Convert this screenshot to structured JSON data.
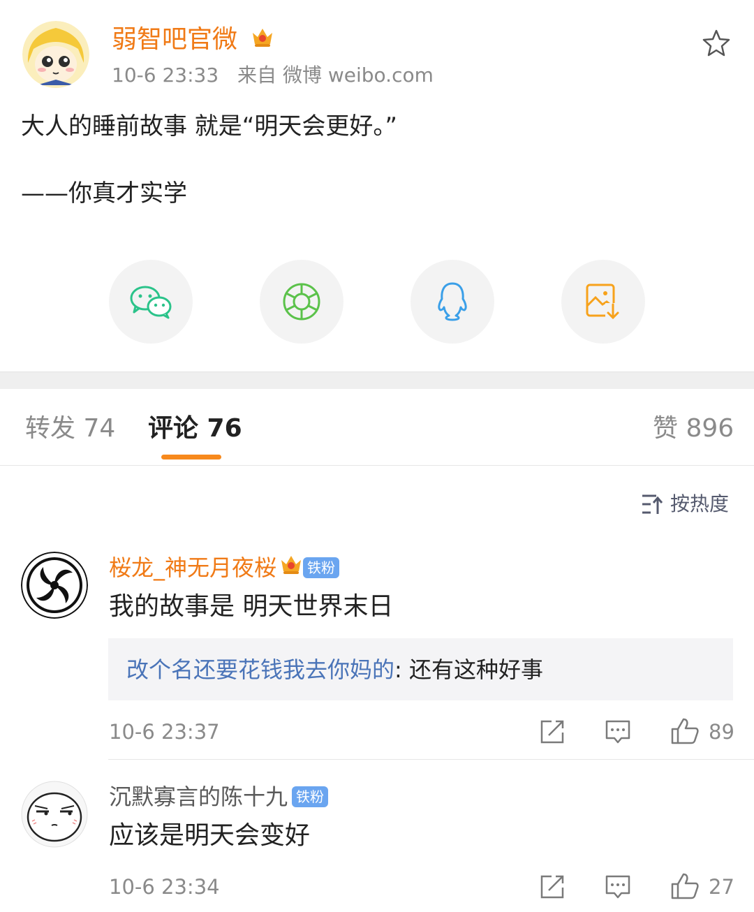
{
  "post": {
    "author": "弱智吧官微",
    "time": "10-6 23:33",
    "source": "来自 微博 weibo.com",
    "line1": "大人的睡前故事 就是“明天会更好。”",
    "line2": "——你真才实学"
  },
  "share_targets": [
    {
      "icon": "wechat-icon",
      "color": "#2bc38a"
    },
    {
      "icon": "moments-icon",
      "color": "#5bc24a"
    },
    {
      "icon": "qq-icon",
      "color": "#3a9fe8"
    },
    {
      "icon": "save-image-icon",
      "color": "#f7a21b"
    }
  ],
  "tabs": {
    "reposts": "转发 74",
    "comments": "评论 76",
    "likes": "赞 896"
  },
  "sort": {
    "label": "按热度"
  },
  "comments": [
    {
      "name": "桜龙_神无月夜桜",
      "badge": "铁粉",
      "text": "我的故事是 明天世界末日",
      "reply_author": "改个名还要花钱我去你妈的",
      "reply_sep": ":",
      "reply_text": " 还有这种好事",
      "time": "10-6 23:37",
      "likes": "89"
    },
    {
      "name": "沉默寡言的陈十九",
      "badge": "铁粉",
      "text": "应该是明天会变好",
      "time": "10-6 23:34",
      "likes": "27"
    }
  ],
  "colors": {
    "accent": "#f07a16",
    "tab_underline": "#f7891c",
    "badge": "#6aa5f0",
    "link": "#4a74b8"
  }
}
